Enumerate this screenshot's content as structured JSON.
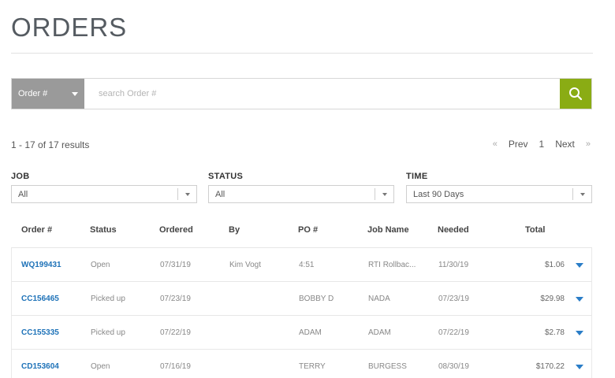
{
  "page": {
    "title": "ORDERS"
  },
  "search": {
    "type_label": "Order #",
    "placeholder": "search Order #"
  },
  "results": {
    "summary": "1 - 17 of 17 results",
    "pager": {
      "first": "«",
      "prev": "Prev",
      "page": "1",
      "next": "Next",
      "last": "»"
    }
  },
  "filters": {
    "job": {
      "label": "JOB",
      "value": "All"
    },
    "status": {
      "label": "STATUS",
      "value": "All"
    },
    "time": {
      "label": "TIME",
      "value": "Last 90 Days"
    }
  },
  "table": {
    "headers": {
      "order": "Order #",
      "status": "Status",
      "ordered": "Ordered",
      "by": "By",
      "po": "PO #",
      "job_name": "Job Name",
      "needed": "Needed",
      "total": "Total"
    },
    "rows": [
      {
        "order": "WQ199431",
        "status": "Open",
        "ordered": "07/31/19",
        "by": "Kim Vogt",
        "po": "4:51",
        "job_name": "RTI Rollbac...",
        "needed": "11/30/19",
        "total": "$1.06"
      },
      {
        "order": "CC156465",
        "status": "Picked up",
        "ordered": "07/23/19",
        "by": "",
        "po": "BOBBY D",
        "job_name": "NADA",
        "needed": "07/23/19",
        "total": "$29.98"
      },
      {
        "order": "CC155335",
        "status": "Picked up",
        "ordered": "07/22/19",
        "by": "",
        "po": "ADAM",
        "job_name": "ADAM",
        "needed": "07/22/19",
        "total": "$2.78"
      },
      {
        "order": "CD153604",
        "status": "Open",
        "ordered": "07/16/19",
        "by": "",
        "po": "TERRY",
        "job_name": "BURGESS",
        "needed": "08/30/19",
        "total": "$170.22"
      }
    ]
  },
  "colors": {
    "accent_green": "#8aac14",
    "link_blue": "#1e72b8",
    "select_gray": "#9a9a9a"
  }
}
